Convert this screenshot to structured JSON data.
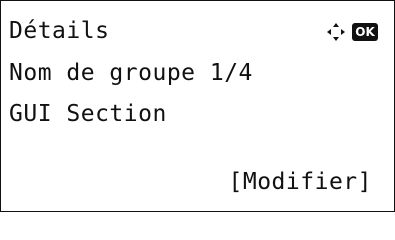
{
  "screen": {
    "title": "Détails",
    "line2": "Nom de groupe 1/4",
    "line3": "GUI Section",
    "action_label": "[Modifier]",
    "ok_badge": "OK",
    "nav_icon": "dpad-icon"
  }
}
